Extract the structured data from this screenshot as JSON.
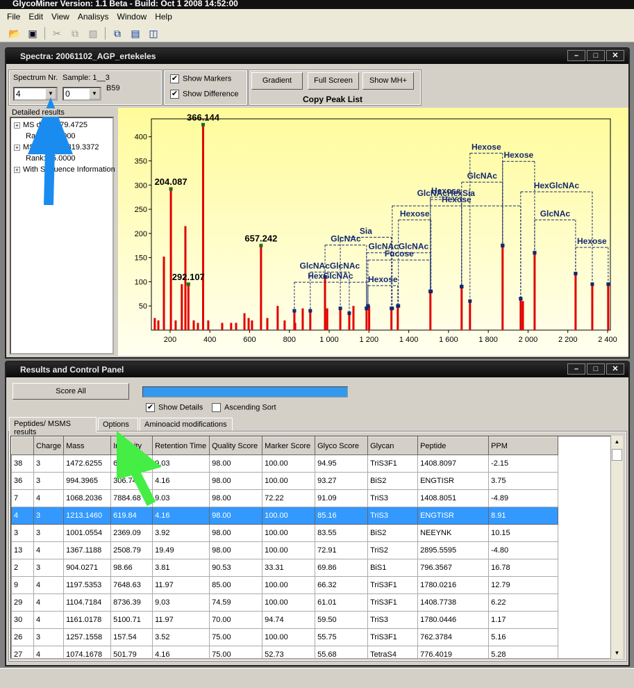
{
  "app": {
    "title": "GlycoMiner Version: 1.1 Beta - Build: Oct  1 2008 14:52:00",
    "menu": [
      "File",
      "Edit",
      "View",
      "Analisys",
      "Window",
      "Help"
    ],
    "toolbar": [
      "open-folder-icon",
      "save-icon",
      "cut-icon",
      "copy-icon",
      "paste-icon",
      "cascade-icon",
      "tile-horizontal-icon",
      "tile-vertical-icon"
    ]
  },
  "spectra": {
    "title": "Spectra: 20061102_AGP_ertekeles",
    "spectrum_label": "Spectrum Nr.",
    "spectrum_value": "4",
    "sample_label": "Sample: 1__3",
    "sample_value": "0",
    "sample_code": "B59",
    "show_markers": "Show Markers",
    "show_difference": "Show Difference",
    "gradient": "Gradient",
    "full_screen": "Full Screen",
    "show_mh": "Show MH+",
    "copy_peak_list": "Copy Peak List",
    "details_title": "Detailed results",
    "tree": [
      {
        "text": "MS data: 979.4725",
        "expand": true
      },
      {
        "text": "Rank: 98.0000",
        "expand": false
      },
      {
        "text": "MSMS data: 819.3372",
        "expand": true
      },
      {
        "text": "Rank: 15.0000",
        "expand": false
      },
      {
        "text": "With Sequence Information",
        "expand": true
      }
    ]
  },
  "chart_data": {
    "type": "bar",
    "xlim": [
      106,
      2414
    ],
    "ylim": [
      0,
      437
    ],
    "xticks": [
      200,
      400,
      600,
      800,
      1000,
      1200,
      1400,
      1600,
      1800,
      2000,
      2200,
      2400
    ],
    "xtick_labels": [
      "200",
      "400",
      "600",
      "800",
      "1 000",
      "1 200",
      "1 400",
      "1 600",
      "1 800",
      "2 000",
      "2 200",
      "2 400"
    ],
    "yticks": [
      50,
      100,
      150,
      200,
      250,
      300,
      350,
      400
    ],
    "peak_color": "#e00000",
    "annotation_color": "#14286e",
    "background": [
      "#fffb9a",
      "#fffff0"
    ],
    "peaks": [
      [
        123,
        25
      ],
      [
        141,
        20
      ],
      [
        169,
        152
      ],
      [
        204.087,
        292
      ],
      [
        228,
        20
      ],
      [
        259,
        95
      ],
      [
        277,
        215
      ],
      [
        292.107,
        95
      ],
      [
        319,
        20
      ],
      [
        340,
        15
      ],
      [
        366.144,
        425
      ],
      [
        392,
        20
      ],
      [
        462,
        15
      ],
      [
        507,
        15
      ],
      [
        532,
        15
      ],
      [
        574,
        35
      ],
      [
        595,
        25
      ],
      [
        612,
        20
      ],
      [
        657.242,
        175
      ],
      [
        689,
        25
      ],
      [
        741,
        50
      ],
      [
        776,
        20
      ],
      [
        825,
        40
      ],
      [
        829,
        15
      ],
      [
        867,
        45
      ],
      [
        905,
        40
      ],
      [
        979,
        110
      ],
      [
        990,
        45
      ],
      [
        1056,
        45
      ],
      [
        1101,
        35
      ],
      [
        1122,
        50
      ],
      [
        1188,
        45
      ],
      [
        1201,
        50
      ],
      [
        1313,
        45
      ],
      [
        1345,
        50
      ],
      [
        1509,
        80
      ],
      [
        1666,
        90
      ],
      [
        1708,
        60
      ],
      [
        1872,
        175
      ],
      [
        1963,
        65
      ],
      [
        1974,
        60
      ],
      [
        2033,
        160
      ],
      [
        2239,
        117
      ],
      [
        2323,
        95
      ],
      [
        2403,
        95
      ]
    ],
    "peak_labels": [
      {
        "mz": 204.087,
        "text": "204.087"
      },
      {
        "mz": 366.144,
        "text": "366.144"
      },
      {
        "mz": 292.107,
        "text": "292.107"
      },
      {
        "mz": 657.242,
        "text": "657.242"
      }
    ],
    "annotations": [
      {
        "label": "HexGlcNAc",
        "from": 825,
        "to": 1188,
        "level": 99
      },
      {
        "label": "GlcNAcGlcNAc",
        "from": 905,
        "to": 1101,
        "level": 120
      },
      {
        "label": "GlcNAc",
        "from": 979,
        "to": 1188,
        "level": 176
      },
      {
        "label": "Sia",
        "from": 1056,
        "to": 1313,
        "level": 192
      },
      {
        "label": "Hexose",
        "from": 1195,
        "to": 1345,
        "level": 92
      },
      {
        "label": "Fucose",
        "from": 1195,
        "to": 1509,
        "level": 145
      },
      {
        "label": "GlcNAcGlcNAc",
        "from": 1188,
        "to": 1509,
        "level": 160
      },
      {
        "label": "Hexose",
        "from": 1348,
        "to": 1512,
        "level": 228
      },
      {
        "label": "Hexose",
        "from": 1317,
        "to": 1963,
        "level": 257
      },
      {
        "label": "GlcNAcHexSia",
        "from": 1509,
        "to": 1666,
        "level": 270
      },
      {
        "label": "Hexose",
        "from": 1509,
        "to": 1666,
        "level": 275
      },
      {
        "label": "GlcNAc",
        "from": 1666,
        "to": 1872,
        "level": 306
      },
      {
        "label": "Hexose",
        "from": 1708,
        "to": 1872,
        "level": 366
      },
      {
        "label": "Hexose",
        "from": 1872,
        "to": 2033,
        "level": 349
      },
      {
        "label": "HexGlcNAc",
        "from": 1963,
        "to": 2323,
        "level": 286
      },
      {
        "label": "GlcNAc",
        "from": 2033,
        "to": 2239,
        "level": 228
      },
      {
        "label": "Hexose",
        "from": 2239,
        "to": 2403,
        "level": 171
      }
    ]
  },
  "results": {
    "title": "Results and Control Panel",
    "score_all": "Score All",
    "progress": 1.0,
    "show_details": "Show Details",
    "ascending_sort": "Ascending Sort",
    "tabs": [
      "Peptides/ MSMS results",
      "Options",
      "Aminoacid modifications"
    ],
    "columns": [
      "",
      "Charge",
      "Mass",
      "Intensity",
      "Retention Time",
      "Quality Score",
      "Marker Score",
      "Glyco Score",
      "Glycan",
      "Peptide",
      "PPM"
    ],
    "rows": [
      [
        "38",
        "3",
        "1472.6255",
        "617.93",
        "9.03",
        "98.00",
        "100.00",
        "94.95",
        "TriS3F1",
        "1408.8097",
        "-2.15"
      ],
      [
        "36",
        "3",
        "994.3965",
        "306.74",
        "4.16",
        "98.00",
        "100.00",
        "93.27",
        "BiS2",
        "ENGTISR",
        "3.75"
      ],
      [
        "7",
        "4",
        "1068.2036",
        "7884.68",
        "9.03",
        "98.00",
        "72.22",
        "91.09",
        "TriS3",
        "1408.8051",
        "-4.89"
      ],
      [
        "4",
        "3",
        "1213.1460",
        "619.84",
        "4.16",
        "98.00",
        "100.00",
        "85.16",
        "TriS3",
        "ENGTISR",
        "8.91"
      ],
      [
        "3",
        "3",
        "1001.0554",
        "2369.09",
        "3.92",
        "98.00",
        "100.00",
        "83.55",
        "BiS2",
        "NEEYNK",
        "10.15"
      ],
      [
        "13",
        "4",
        "1367.1188",
        "2508.79",
        "19.49",
        "98.00",
        "100.00",
        "72.91",
        "TriS2",
        "2895.5595",
        "-4.80"
      ],
      [
        "2",
        "3",
        "904.0271",
        "98.66",
        "3.81",
        "90.53",
        "33.31",
        "69.86",
        "BiS1",
        "796.3567",
        "16.78"
      ],
      [
        "9",
        "4",
        "1197.5353",
        "7648.63",
        "11.97",
        "85.00",
        "100.00",
        "66.32",
        "TriS3F1",
        "1780.0216",
        "12.79"
      ],
      [
        "29",
        "4",
        "1104.7184",
        "8736.39",
        "9.03",
        "74.59",
        "100.00",
        "61.01",
        "TriS3F1",
        "1408.7738",
        "6.22"
      ],
      [
        "30",
        "4",
        "1161.0178",
        "5100.71",
        "11.97",
        "70.00",
        "94.74",
        "59.50",
        "TriS3",
        "1780.0446",
        "1.17"
      ],
      [
        "26",
        "3",
        "1257.1558",
        "157.54",
        "3.52",
        "75.00",
        "100.00",
        "55.75",
        "TriS3F1",
        "762.3784",
        "5.16"
      ],
      [
        "27",
        "4",
        "1074.1678",
        "501.79",
        "4.16",
        "75.00",
        "52.73",
        "55.68",
        "TetraS4",
        "776.4019",
        "5.28"
      ]
    ],
    "selected_row": 3
  }
}
